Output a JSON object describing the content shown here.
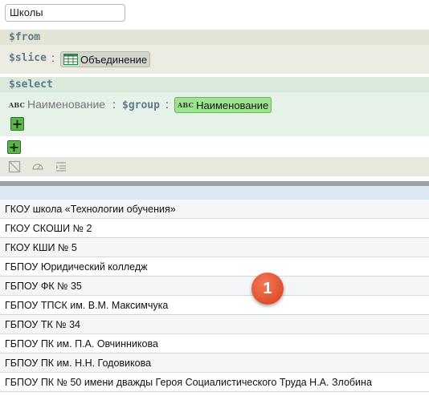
{
  "search": {
    "value": "Школы"
  },
  "from": {
    "keyword": "$from",
    "slice_keyword": "$slice",
    "colon": ":",
    "slice_value": "Объединение"
  },
  "select": {
    "keyword": "$select",
    "type_label": "ABC",
    "field_name": "Наименование",
    "colon": ":",
    "group_keyword": "$group",
    "group_value": "Наименование"
  },
  "buttons": {
    "plus": "+"
  },
  "toolbar_icons": [
    "no-image-icon",
    "gauge-icon",
    "list-indent-icon"
  ],
  "results": {
    "rows": [
      "ГКОУ школа «Технологии обучения»",
      "ГКОУ СКОШИ № 2",
      "ГКОУ КШИ № 5",
      "ГБПОУ Юридический колледж",
      "ГБПОУ ФК № 35",
      "ГБПОУ ТПСК им. В.М. Максимчука",
      "ГБПОУ ТК № 34",
      "ГБПОУ ПК им. П.А. Овчинникова",
      "ГБПОУ ПК им. Н.Н. Годовикова",
      "ГБПОУ ПК № 50 имени дважды Героя Социалистического Труда Н.А. Злобина"
    ]
  },
  "badge": {
    "number": "1"
  },
  "colors": {
    "accent_green": "#9ee38e",
    "badge": "#e04f2d",
    "keyword": "#5f7a8a"
  }
}
